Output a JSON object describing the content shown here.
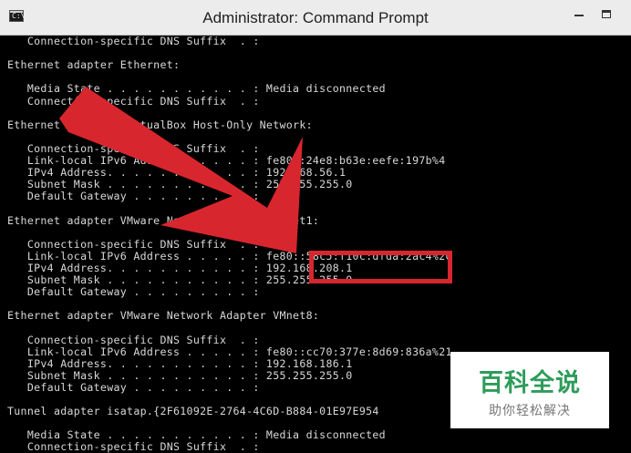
{
  "window": {
    "title": "Administrator: Command Prompt",
    "icon": "cmd-icon",
    "icon_prompt": "C:\\"
  },
  "console": {
    "lines": [
      "   Connection-specific DNS Suffix  . :",
      "",
      "Ethernet adapter Ethernet:",
      "",
      "   Media State . . . . . . . . . . . : Media disconnected",
      "   Connection-specific DNS Suffix  . :",
      "",
      "Ethernet adapter VirtualBox Host-Only Network:",
      "",
      "   Connection-specific DNS Suffix  . :",
      "   Link-local IPv6 Address . . . . . : fe80::24e8:b63e:eefe:197b%4",
      "   IPv4 Address. . . . . . . . . . . : 192.168.56.1",
      "   Subnet Mask . . . . . . . . . . . : 255.255.255.0",
      "   Default Gateway . . . . . . . . . :",
      "",
      "Ethernet adapter VMware Network Adapter VMnet1:",
      "",
      "   Connection-specific DNS Suffix  . :",
      "   Link-local IPv6 Address . . . . . : fe80::58c5:f10c:dfda:2ac4%20",
      "   IPv4 Address. . . . . . . . . . . : 192.168.208.1",
      "   Subnet Mask . . . . . . . . . . . : 255.255.255.0",
      "   Default Gateway . . . . . . . . . :",
      "",
      "Ethernet adapter VMware Network Adapter VMnet8:",
      "",
      "   Connection-specific DNS Suffix  . :",
      "   Link-local IPv6 Address . . . . . : fe80::cc70:377e:8d69:836a%21",
      "   IPv4 Address. . . . . . . . . . . : 192.168.186.1",
      "   Subnet Mask . . . . . . . . . . . : 255.255.255.0",
      "   Default Gateway . . . . . . . . . :",
      "",
      "Tunnel adapter isatap.{2F61092E-2764-4C6D-B884-01E97E954",
      "",
      "   Media State . . . . . . . . . . . : Media disconnected",
      "   Connection-specific DNS Suffix  . :"
    ]
  },
  "annotation": {
    "arrow_color": "#d8262f",
    "highlight_color": "#d8262f",
    "highlighted_value": "192.168.208.1"
  },
  "watermark": {
    "logo": "百科全说",
    "subtitle": "助你轻松解决",
    "logo_color": "#2e9c5a"
  }
}
